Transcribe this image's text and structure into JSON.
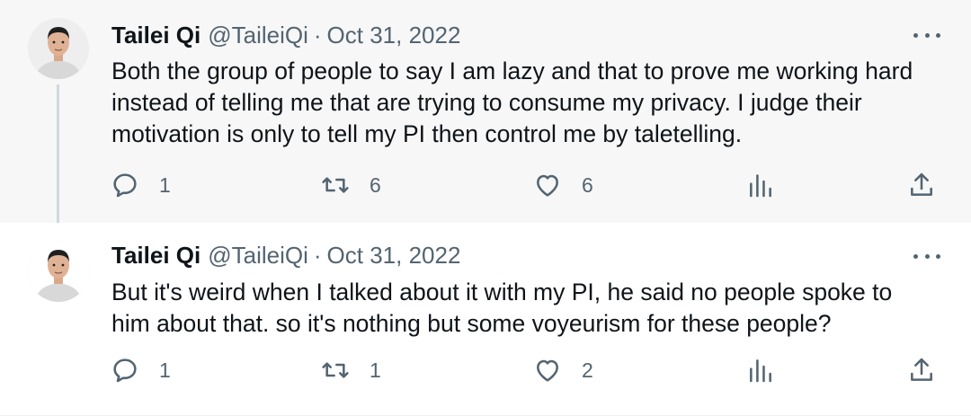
{
  "tweets": [
    {
      "name": "Tailei Qi",
      "handle": "@TaileiQi",
      "separator": "·",
      "date": "Oct 31, 2022",
      "text": "Both the group of people to say I am lazy and that to prove me working hard instead of telling me that are trying to consume my privacy. I judge their motivation is only to tell my PI then control me by taletelling.",
      "replies": "1",
      "retweets": "6",
      "likes": "6"
    },
    {
      "name": "Tailei Qi",
      "handle": "@TaileiQi",
      "separator": "·",
      "date": "Oct 31, 2022",
      "text": "But it's weird when I talked about it with my PI, he said no people spoke to him about that. so it's nothing but some voyeurism for these people?",
      "replies": "1",
      "retweets": "1",
      "likes": "2"
    }
  ],
  "icons": {
    "reply": "reply-icon",
    "retweet": "retweet-icon",
    "like": "heart-icon",
    "views": "views-icon",
    "share": "share-icon",
    "more": "more-icon"
  },
  "colors": {
    "secondary_text": "#536471",
    "primary_text": "#0f1419",
    "thread_line": "#cfd9de",
    "highlight_bg": "#f7f7f7"
  }
}
